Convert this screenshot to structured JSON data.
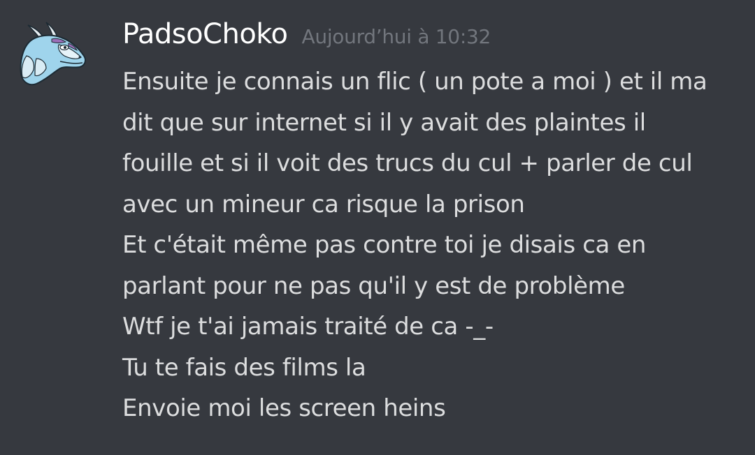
{
  "message": {
    "username": "PadsoChoko",
    "timestamp": "Aujourd’hui à 10:32",
    "avatar_icon": "dragon-avatar-icon",
    "lines": [
      "Ensuite je connais un flic ( un pote a moi ) et il ma",
      "dit que sur internet si il y avait des plaintes il",
      "fouille et si il voit des trucs du cul + parler de cul",
      "avec un mineur ca risque la prison",
      "Et c'était même pas contre toi je disais ca en",
      "parlant pour ne pas qu'il y est de problème",
      "Wtf je t'ai jamais traité de ca -_-",
      "Tu te fais des films la",
      "Envoie moi les screen heins"
    ]
  },
  "colors": {
    "background": "#36393f",
    "username": "#ffffff",
    "timestamp": "#72767d",
    "text": "#dcddde"
  }
}
